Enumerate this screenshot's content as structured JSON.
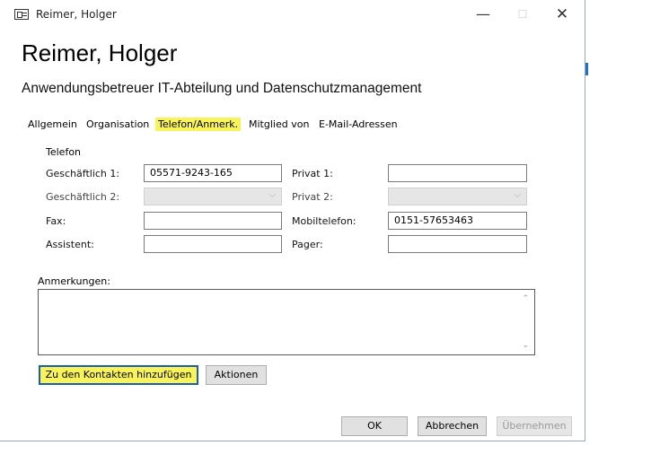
{
  "window": {
    "title": "Reimer, Holger",
    "minimize_glyph": "—",
    "maximize_glyph": "☐",
    "close_glyph": "✕"
  },
  "contact": {
    "name": "Reimer, Holger",
    "role": "Anwendungsbetreuer IT-Abteilung und Datenschutzmanagement"
  },
  "tabs": [
    {
      "label": "Allgemein",
      "active": false
    },
    {
      "label": "Organisation",
      "active": false
    },
    {
      "label": "Telefon/Anmerk.",
      "active": true
    },
    {
      "label": "Mitglied von",
      "active": false
    },
    {
      "label": "E-Mail-Adressen",
      "active": false
    }
  ],
  "telefon": {
    "group_label": "Telefon",
    "geschaeftlich1": {
      "label": "Geschäftlich 1:",
      "value": "05571-9243-165"
    },
    "geschaeftlich2": {
      "label": "Geschäftlich 2:",
      "value": ""
    },
    "fax": {
      "label": "Fax:",
      "value": ""
    },
    "assistent": {
      "label": "Assistent:",
      "value": ""
    },
    "privat1": {
      "label": "Privat 1:",
      "value": ""
    },
    "privat2": {
      "label": "Privat 2:",
      "value": ""
    },
    "mobiltelefon": {
      "label": "Mobiltelefon:",
      "value": "0151-57653463"
    },
    "pager": {
      "label": "Pager:",
      "value": ""
    }
  },
  "anmerkungen": {
    "label": "Anmerkungen:",
    "value": ""
  },
  "buttons": {
    "add_contacts": "Zu den Kontakten hinzufügen",
    "aktionen": "Aktionen",
    "ok": "OK",
    "abbrechen": "Abbrechen",
    "uebernehmen": "Übernehmen"
  },
  "glyphs": {
    "chevron": "⌵",
    "scroll_up": "⌃",
    "scroll_down": "⌄"
  },
  "colors": {
    "highlight": "#f9f35a",
    "focus_border": "#1a5fb4"
  }
}
